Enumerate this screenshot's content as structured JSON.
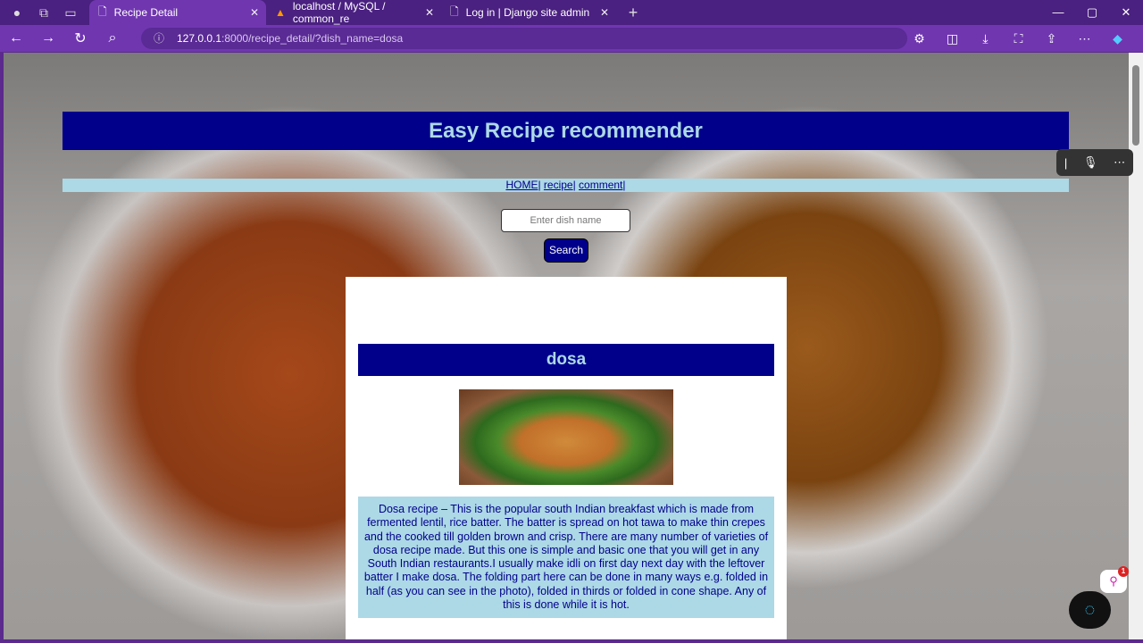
{
  "browser": {
    "tabs": [
      {
        "title": "Recipe Detail"
      },
      {
        "title": "localhost / MySQL / common_re"
      },
      {
        "title": "Log in | Django site admin"
      }
    ],
    "url_host": "127.0.0.1",
    "url_rest": ":8000/recipe_detail/?dish_name=dosa"
  },
  "page": {
    "title": "Easy Recipe recommender",
    "nav": [
      {
        "label": "HOME"
      },
      {
        "label": "recipe"
      },
      {
        "label": "comment"
      }
    ],
    "search_placeholder": "Enter dish name",
    "search_button": "Search",
    "dish_name": "dosa",
    "description": "Dosa recipe – This is the popular south Indian breakfast which is made from fermented lentil, rice batter. The batter is spread on hot tawa to make thin crepes and the cooked till golden brown and crisp. There are many number of varieties of dosa recipe made. But this one is simple and basic one that you will get in any South Indian restaurants.I usually make idli on first day next day with the leftover batter I make dosa. The folding part here can be done in many ways e.g. folded in half (as you can see in the photo), folded in thirds or folded in cone shape. Any of this is done while it is hot."
  },
  "widgets": {
    "notification_count": "1"
  }
}
